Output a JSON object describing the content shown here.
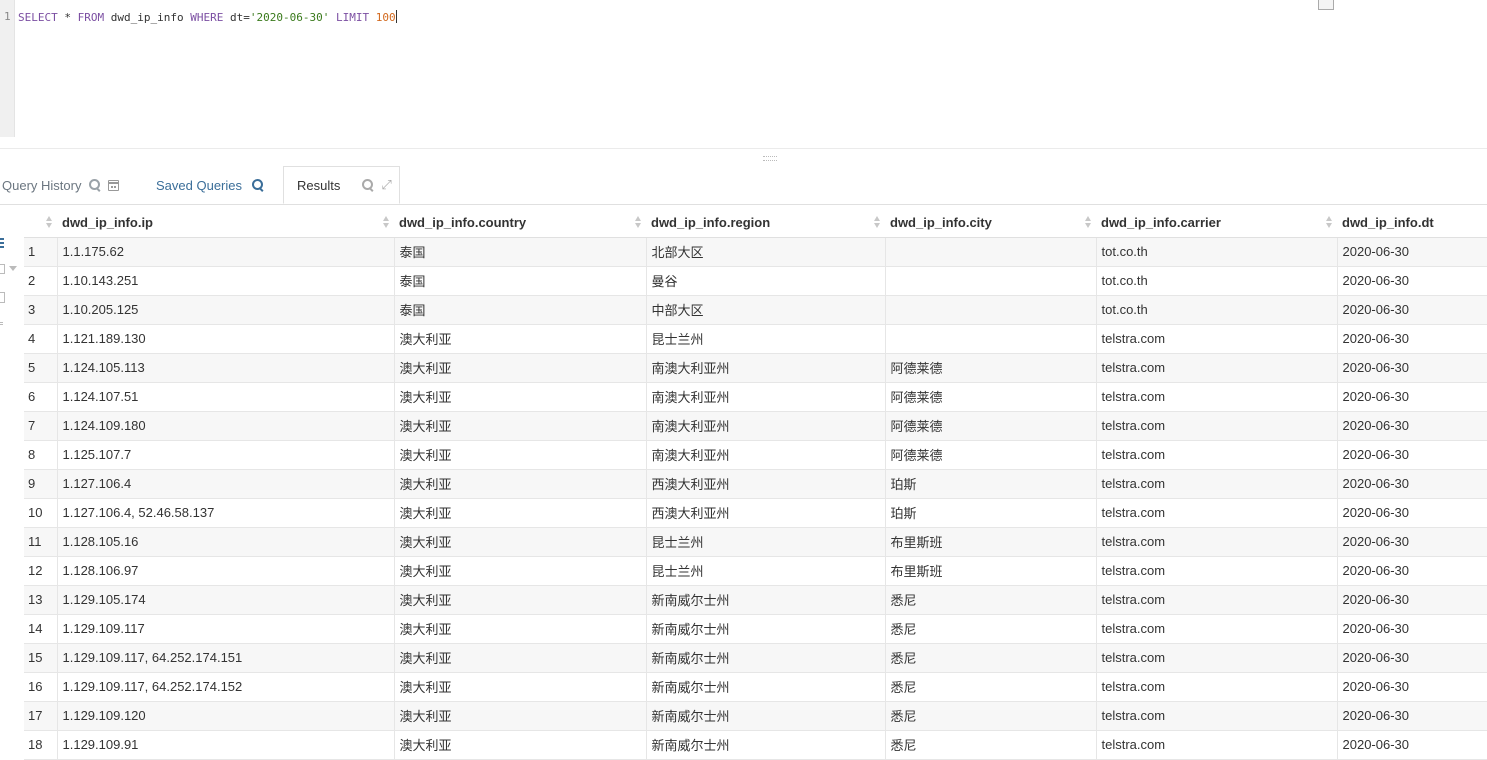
{
  "editor": {
    "line_number": "1",
    "tokens": {
      "select": "SELECT",
      "star": "*",
      "from": "FROM",
      "table": "dwd_ip_info",
      "where": "WHERE",
      "column": "dt",
      "eq": "=",
      "date": "'2020-06-30'",
      "limit": "LIMIT",
      "limit_value": "100"
    }
  },
  "tabs": {
    "query_history": "Query History",
    "saved_queries": "Saved Queries",
    "results": "Results"
  },
  "results": {
    "columns": [
      "dwd_ip_info.ip",
      "dwd_ip_info.country",
      "dwd_ip_info.region",
      "dwd_ip_info.city",
      "dwd_ip_info.carrier",
      "dwd_ip_info.dt"
    ],
    "rows": [
      [
        "1",
        "1.1.175.62",
        "泰国",
        "北部大区",
        "",
        "tot.co.th",
        "2020-06-30"
      ],
      [
        "2",
        "1.10.143.251",
        "泰国",
        "曼谷",
        "",
        "tot.co.th",
        "2020-06-30"
      ],
      [
        "3",
        "1.10.205.125",
        "泰国",
        "中部大区",
        "",
        "tot.co.th",
        "2020-06-30"
      ],
      [
        "4",
        "1.121.189.130",
        "澳大利亚",
        "昆士兰州",
        "",
        "telstra.com",
        "2020-06-30"
      ],
      [
        "5",
        "1.124.105.113",
        "澳大利亚",
        "南澳大利亚州",
        "阿德莱德",
        "telstra.com",
        "2020-06-30"
      ],
      [
        "6",
        "1.124.107.51",
        "澳大利亚",
        "南澳大利亚州",
        "阿德莱德",
        "telstra.com",
        "2020-06-30"
      ],
      [
        "7",
        "1.124.109.180",
        "澳大利亚",
        "南澳大利亚州",
        "阿德莱德",
        "telstra.com",
        "2020-06-30"
      ],
      [
        "8",
        "1.125.107.7",
        "澳大利亚",
        "南澳大利亚州",
        "阿德莱德",
        "telstra.com",
        "2020-06-30"
      ],
      [
        "9",
        "1.127.106.4",
        "澳大利亚",
        "西澳大利亚州",
        "珀斯",
        "telstra.com",
        "2020-06-30"
      ],
      [
        "10",
        "1.127.106.4, 52.46.58.137",
        "澳大利亚",
        "西澳大利亚州",
        "珀斯",
        "telstra.com",
        "2020-06-30"
      ],
      [
        "11",
        "1.128.105.16",
        "澳大利亚",
        "昆士兰州",
        "布里斯班",
        "telstra.com",
        "2020-06-30"
      ],
      [
        "12",
        "1.128.106.97",
        "澳大利亚",
        "昆士兰州",
        "布里斯班",
        "telstra.com",
        "2020-06-30"
      ],
      [
        "13",
        "1.129.105.174",
        "澳大利亚",
        "新南威尔士州",
        "悉尼",
        "telstra.com",
        "2020-06-30"
      ],
      [
        "14",
        "1.129.109.117",
        "澳大利亚",
        "新南威尔士州",
        "悉尼",
        "telstra.com",
        "2020-06-30"
      ],
      [
        "15",
        "1.129.109.117, 64.252.174.151",
        "澳大利亚",
        "新南威尔士州",
        "悉尼",
        "telstra.com",
        "2020-06-30"
      ],
      [
        "16",
        "1.129.109.117, 64.252.174.152",
        "澳大利亚",
        "新南威尔士州",
        "悉尼",
        "telstra.com",
        "2020-06-30"
      ],
      [
        "17",
        "1.129.109.120",
        "澳大利亚",
        "新南威尔士州",
        "悉尼",
        "telstra.com",
        "2020-06-30"
      ],
      [
        "18",
        "1.129.109.91",
        "澳大利亚",
        "新南威尔士州",
        "悉尼",
        "telstra.com",
        "2020-06-30"
      ]
    ]
  }
}
